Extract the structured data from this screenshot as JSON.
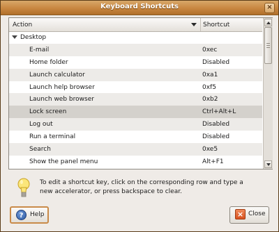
{
  "window": {
    "title": "Keyboard Shortcuts",
    "close_glyph": "×"
  },
  "table": {
    "columns": {
      "action": "Action",
      "shortcut": "Shortcut"
    },
    "group": {
      "label": "Desktop"
    },
    "rows": [
      {
        "action": "E-mail",
        "shortcut": "0xec"
      },
      {
        "action": "Home folder",
        "shortcut": "Disabled"
      },
      {
        "action": "Launch calculator",
        "shortcut": "0xa1"
      },
      {
        "action": "Launch help browser",
        "shortcut": "0xf5"
      },
      {
        "action": "Launch web browser",
        "shortcut": "0xb2"
      },
      {
        "action": "Lock screen",
        "shortcut": "Ctrl+Alt+L"
      },
      {
        "action": "Log out",
        "shortcut": "Disabled"
      },
      {
        "action": "Run a terminal",
        "shortcut": "Disabled"
      },
      {
        "action": "Search",
        "shortcut": "0xe5"
      },
      {
        "action": "Show the panel menu",
        "shortcut": "Alt+F1"
      }
    ]
  },
  "hint": {
    "text": "To edit a shortcut key, click on the corresponding row and type a new accelerator, or press backspace to clear."
  },
  "buttons": {
    "help": {
      "label": "Help",
      "icon_glyph": "?"
    },
    "close": {
      "label": "Close",
      "icon_glyph": "×"
    }
  }
}
